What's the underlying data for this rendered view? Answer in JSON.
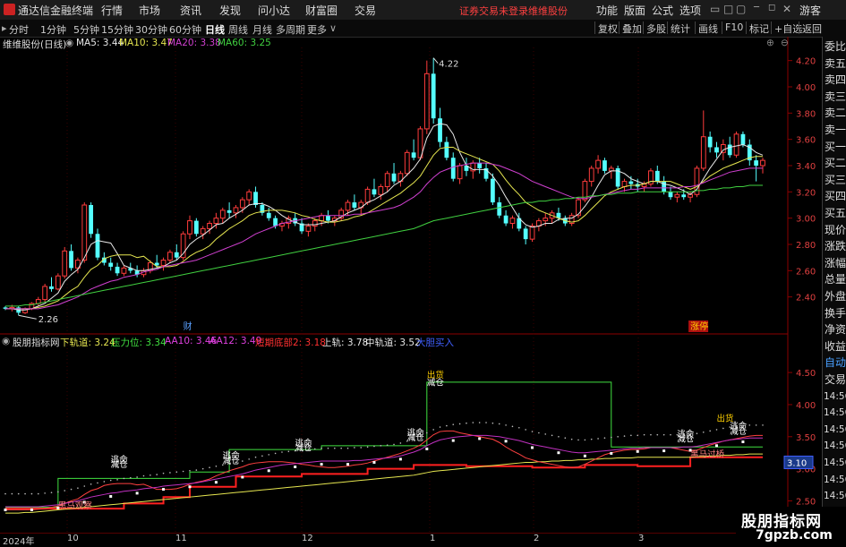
{
  "menubar": {
    "title": "通达信金融终端",
    "items": [
      "行情",
      "市场",
      "资讯",
      "发现",
      "问小达",
      "财富圈",
      "交易"
    ],
    "status": "证券交易未登录",
    "stock_name": "维维股份",
    "right_items": [
      "功能",
      "版面",
      "公式",
      "选项"
    ],
    "guest": "游客"
  },
  "periodbar": {
    "periods": [
      "分时",
      "1分钟",
      "5分钟",
      "15分钟",
      "30分钟",
      "60分钟",
      "日线",
      "周线",
      "月线",
      "多周期",
      "更多"
    ],
    "active_period": "日线",
    "right_buttons": [
      "复权",
      "叠加",
      "多股",
      "统计",
      "画线",
      "F10",
      "标记",
      "+自选",
      "返回"
    ]
  },
  "main_panel": {
    "title": "维维股份(日线)",
    "indicators": [
      {
        "label": "MA5: 3.44",
        "color": "#e8e8e8"
      },
      {
        "label": "MA10: 3.47",
        "color": "#e6e650"
      },
      {
        "label": "MA20: 3.38",
        "color": "#d040d0"
      },
      {
        "label": "MA60: 3.25",
        "color": "#40d040"
      }
    ],
    "high_label": "4.22",
    "low_label": "2.26",
    "markers": [
      {
        "text": "财",
        "color": "#5aa0ff"
      },
      {
        "text": "涨停",
        "color": "#ffd000",
        "bg": "#b01010"
      }
    ],
    "y_ticks": [
      "4.20",
      "4.00",
      "3.80",
      "3.60",
      "3.40",
      "3.20",
      "3.00",
      "2.80",
      "2.60",
      "2.40"
    ]
  },
  "sub_panel": {
    "title": "股朋指标网",
    "indicators": [
      {
        "label": "下轨道: 3.24",
        "color": "#e6e650"
      },
      {
        "label": "压力位: 3.34",
        "color": "#40e040"
      },
      {
        "label": "AA10: 3.46",
        "color": "#e040e0"
      },
      {
        "label": "AA12: 3.49",
        "color": "#e040e0"
      },
      {
        "label": "短期底部2: 3.18",
        "color": "#ff3030"
      },
      {
        "label": "上轨: 3.78",
        "color": "#e8e8e8"
      },
      {
        "label": "中轨道: 3.52",
        "color": "#e8e8e8"
      },
      {
        "label": "大胆买入",
        "color": "#4060ff"
      }
    ],
    "y_ticks": [
      "4.50",
      "4.00",
      "3.50",
      "3.00",
      "2.50"
    ],
    "current_value": "3.10",
    "annotations": [
      "逃命",
      "减仓",
      "逃命",
      "减仓",
      "逃命",
      "减仓",
      "出货",
      "减仓",
      "逃命",
      "减仓",
      "逃命",
      "减仓",
      "出货",
      "逃命",
      "减仓",
      "黑马观察",
      "黑马过桥"
    ]
  },
  "sidebar": {
    "items": [
      "委比",
      "卖五",
      "卖四",
      "卖三",
      "卖二",
      "卖一",
      "买一",
      "买二",
      "买三",
      "买四",
      "买五",
      "现价",
      "涨跌",
      "涨幅",
      "总量",
      "外盘",
      "换手",
      "净资",
      "收益",
      "自动",
      "交易",
      "14:56",
      "14:56",
      "14:56",
      "14:56",
      "14:56",
      "14:56",
      "14:56",
      "14:56"
    ]
  },
  "datebar": {
    "labels": [
      "2024年",
      "10",
      "11",
      "12",
      "1",
      "2",
      "3"
    ]
  },
  "watermark": {
    "line1": "股朋指标网",
    "line2": "7gpzb.com"
  },
  "chart_data": {
    "type": "candlestick",
    "title": "维维股份(日线)",
    "ylim": [
      2.2,
      4.3
    ],
    "candles": [
      [
        2.32,
        2.33,
        2.3,
        2.31
      ],
      [
        2.31,
        2.34,
        2.29,
        2.32
      ],
      [
        2.32,
        2.33,
        2.26,
        2.28
      ],
      [
        2.28,
        2.32,
        2.27,
        2.31
      ],
      [
        2.31,
        2.36,
        2.3,
        2.35
      ],
      [
        2.35,
        2.4,
        2.33,
        2.38
      ],
      [
        2.38,
        2.5,
        2.36,
        2.48
      ],
      [
        2.48,
        2.55,
        2.44,
        2.46
      ],
      [
        2.46,
        2.58,
        2.45,
        2.56
      ],
      [
        2.56,
        2.78,
        2.54,
        2.75
      ],
      [
        2.75,
        2.8,
        2.6,
        2.62
      ],
      [
        2.62,
        2.7,
        2.58,
        2.68
      ],
      [
        2.68,
        3.12,
        2.66,
        3.1
      ],
      [
        3.1,
        3.12,
        2.85,
        2.88
      ],
      [
        2.88,
        2.92,
        2.68,
        2.7
      ],
      [
        2.7,
        2.74,
        2.64,
        2.66
      ],
      [
        2.66,
        2.7,
        2.6,
        2.63
      ],
      [
        2.63,
        2.66,
        2.56,
        2.58
      ],
      [
        2.58,
        2.64,
        2.56,
        2.62
      ],
      [
        2.62,
        2.66,
        2.58,
        2.6
      ],
      [
        2.6,
        2.64,
        2.55,
        2.57
      ],
      [
        2.57,
        2.62,
        2.55,
        2.6
      ],
      [
        2.6,
        2.68,
        2.58,
        2.66
      ],
      [
        2.66,
        2.72,
        2.62,
        2.64
      ],
      [
        2.64,
        2.7,
        2.6,
        2.68
      ],
      [
        2.68,
        2.76,
        2.66,
        2.74
      ],
      [
        2.74,
        2.8,
        2.68,
        2.7
      ],
      [
        2.7,
        2.9,
        2.68,
        2.88
      ],
      [
        2.88,
        3.02,
        2.84,
        2.98
      ],
      [
        2.98,
        3.0,
        2.86,
        2.88
      ],
      [
        2.88,
        2.94,
        2.84,
        2.92
      ],
      [
        2.92,
        2.98,
        2.88,
        2.96
      ],
      [
        2.96,
        3.04,
        2.92,
        3.0
      ],
      [
        3.0,
        3.08,
        2.96,
        3.06
      ],
      [
        3.06,
        3.12,
        3.0,
        3.04
      ],
      [
        3.04,
        3.1,
        3.0,
        3.08
      ],
      [
        3.08,
        3.16,
        3.04,
        3.14
      ],
      [
        3.14,
        3.22,
        3.1,
        3.2
      ],
      [
        3.2,
        3.24,
        3.08,
        3.1
      ],
      [
        3.1,
        3.12,
        3.02,
        3.04
      ],
      [
        3.04,
        3.08,
        2.98,
        3.0
      ],
      [
        3.0,
        3.02,
        2.92,
        2.94
      ],
      [
        2.94,
        2.98,
        2.9,
        2.96
      ],
      [
        2.96,
        3.02,
        2.92,
        3.0
      ],
      [
        3.0,
        3.04,
        2.94,
        2.96
      ],
      [
        2.96,
        3.0,
        2.88,
        2.9
      ],
      [
        2.9,
        2.96,
        2.86,
        2.94
      ],
      [
        2.94,
        3.0,
        2.9,
        2.98
      ],
      [
        2.98,
        3.04,
        2.94,
        3.02
      ],
      [
        3.02,
        3.06,
        2.96,
        2.98
      ],
      [
        2.98,
        3.02,
        2.94,
        3.0
      ],
      [
        3.0,
        3.08,
        2.98,
        3.06
      ],
      [
        3.06,
        3.14,
        3.02,
        3.12
      ],
      [
        3.12,
        3.18,
        3.06,
        3.08
      ],
      [
        3.08,
        3.14,
        3.02,
        3.12
      ],
      [
        3.12,
        3.24,
        3.1,
        3.22
      ],
      [
        3.22,
        3.3,
        3.16,
        3.18
      ],
      [
        3.18,
        3.26,
        3.14,
        3.24
      ],
      [
        3.24,
        3.36,
        3.2,
        3.34
      ],
      [
        3.34,
        3.42,
        3.26,
        3.28
      ],
      [
        3.28,
        3.36,
        3.24,
        3.34
      ],
      [
        3.34,
        3.52,
        3.32,
        3.5
      ],
      [
        3.5,
        3.6,
        3.44,
        3.46
      ],
      [
        3.46,
        3.7,
        3.44,
        3.68
      ],
      [
        3.68,
        4.2,
        3.64,
        4.1
      ],
      [
        4.1,
        4.22,
        3.72,
        3.76
      ],
      [
        3.76,
        3.84,
        3.54,
        3.58
      ],
      [
        3.58,
        3.62,
        3.44,
        3.46
      ],
      [
        3.46,
        3.5,
        3.28,
        3.3
      ],
      [
        3.3,
        3.42,
        3.26,
        3.4
      ],
      [
        3.4,
        3.46,
        3.32,
        3.36
      ],
      [
        3.36,
        3.44,
        3.3,
        3.42
      ],
      [
        3.42,
        3.46,
        3.34,
        3.38
      ],
      [
        3.38,
        3.42,
        3.28,
        3.3
      ],
      [
        3.3,
        3.34,
        3.1,
        3.12
      ],
      [
        3.12,
        3.16,
        3.0,
        3.02
      ],
      [
        3.02,
        3.06,
        2.94,
        2.96
      ],
      [
        2.96,
        3.02,
        2.92,
        3.0
      ],
      [
        3.0,
        3.04,
        2.9,
        2.92
      ],
      [
        2.92,
        2.94,
        2.8,
        2.84
      ],
      [
        2.84,
        2.96,
        2.82,
        2.94
      ],
      [
        2.94,
        3.0,
        2.9,
        2.98
      ],
      [
        2.98,
        3.04,
        2.94,
        3.0
      ],
      [
        3.0,
        3.06,
        2.96,
        3.04
      ],
      [
        3.04,
        3.08,
        2.98,
        3.0
      ],
      [
        3.0,
        3.02,
        2.94,
        2.96
      ],
      [
        2.96,
        3.04,
        2.94,
        3.02
      ],
      [
        3.02,
        3.16,
        3.0,
        3.14
      ],
      [
        3.14,
        3.3,
        3.12,
        3.28
      ],
      [
        3.28,
        3.4,
        3.24,
        3.38
      ],
      [
        3.38,
        3.48,
        3.34,
        3.44
      ],
      [
        3.44,
        3.46,
        3.34,
        3.36
      ],
      [
        3.36,
        3.4,
        3.3,
        3.38
      ],
      [
        3.38,
        3.4,
        3.22,
        3.24
      ],
      [
        3.24,
        3.3,
        3.2,
        3.28
      ],
      [
        3.28,
        3.32,
        3.22,
        3.26
      ],
      [
        3.26,
        3.3,
        3.2,
        3.24
      ],
      [
        3.24,
        3.28,
        3.2,
        3.26
      ],
      [
        3.26,
        3.38,
        3.24,
        3.36
      ],
      [
        3.36,
        3.4,
        3.26,
        3.28
      ],
      [
        3.28,
        3.32,
        3.18,
        3.2
      ],
      [
        3.2,
        3.24,
        3.14,
        3.16
      ],
      [
        3.16,
        3.2,
        3.12,
        3.18
      ],
      [
        3.18,
        3.22,
        3.14,
        3.16
      ],
      [
        3.16,
        3.2,
        3.12,
        3.18
      ],
      [
        3.18,
        3.4,
        3.16,
        3.38
      ],
      [
        3.38,
        3.82,
        3.36,
        3.62
      ],
      [
        3.62,
        3.66,
        3.5,
        3.54
      ],
      [
        3.54,
        3.58,
        3.46,
        3.5
      ],
      [
        3.5,
        3.6,
        3.44,
        3.56
      ],
      [
        3.56,
        3.62,
        3.46,
        3.48
      ],
      [
        3.48,
        3.66,
        3.46,
        3.64
      ],
      [
        3.64,
        3.66,
        3.54,
        3.56
      ],
      [
        3.56,
        3.6,
        3.4,
        3.44
      ],
      [
        3.44,
        3.48,
        3.28,
        3.4
      ],
      [
        3.4,
        3.46,
        3.34,
        3.44
      ]
    ],
    "ma": {
      "MA5": [
        2.31,
        2.31,
        2.3,
        2.3,
        2.31,
        2.33,
        2.35,
        2.39,
        2.43,
        2.52,
        2.57,
        2.61,
        2.7,
        2.8,
        2.83,
        2.82,
        2.81,
        2.73,
        2.64,
        2.62,
        2.6,
        2.6,
        2.61,
        2.62,
        2.63,
        2.66,
        2.68,
        2.73,
        2.8,
        2.84,
        2.87,
        2.91,
        2.95,
        2.96,
        3.0,
        3.03,
        3.06,
        3.1,
        3.11,
        3.11,
        3.09,
        3.06,
        3.02,
        2.99,
        2.97,
        2.95,
        2.95,
        2.95,
        2.96,
        2.97,
        2.98,
        3.01,
        3.04,
        3.06,
        3.08,
        3.12,
        3.14,
        3.17,
        3.2,
        3.25,
        3.28,
        3.33,
        3.38,
        3.45,
        3.61,
        3.7,
        3.72,
        3.71,
        3.64,
        3.5,
        3.4,
        3.37,
        3.37,
        3.37,
        3.32,
        3.25,
        3.16,
        3.08,
        3.0,
        2.95,
        2.93,
        2.94,
        2.96,
        2.96,
        2.99,
        3.0,
        3.0,
        3.03,
        3.09,
        3.16,
        3.25,
        3.33,
        3.36,
        3.36,
        3.34,
        3.3,
        3.28,
        3.26,
        3.28,
        3.28,
        3.26,
        3.25,
        3.23,
        3.21,
        3.18,
        3.22,
        3.3,
        3.38,
        3.45,
        3.52,
        3.54,
        3.55,
        3.56,
        3.54,
        3.5,
        3.48
      ],
      "MA10": [
        2.31,
        2.31,
        2.31,
        2.31,
        2.31,
        2.32,
        2.33,
        2.35,
        2.37,
        2.41,
        2.45,
        2.48,
        2.55,
        2.61,
        2.64,
        2.69,
        2.71,
        2.72,
        2.72,
        2.72,
        2.7,
        2.71,
        2.67,
        2.63,
        2.63,
        2.63,
        2.64,
        2.67,
        2.71,
        2.74,
        2.76,
        2.79,
        2.84,
        2.88,
        2.92,
        2.95,
        2.98,
        3.02,
        3.04,
        3.05,
        3.06,
        3.06,
        3.06,
        3.05,
        3.04,
        3.02,
        3.01,
        2.99,
        2.98,
        2.97,
        2.97,
        2.98,
        2.99,
        3.01,
        3.02,
        3.04,
        3.07,
        3.1,
        3.13,
        3.16,
        3.19,
        3.23,
        3.27,
        3.32,
        3.4,
        3.48,
        3.53,
        3.54,
        3.54,
        3.51,
        3.49,
        3.47,
        3.45,
        3.43,
        3.41,
        3.36,
        3.29,
        3.23,
        3.18,
        3.12,
        3.09,
        3.06,
        3.04,
        3.02,
        3.0,
        2.98,
        2.97,
        2.98,
        3.02,
        3.07,
        3.12,
        3.17,
        3.2,
        3.22,
        3.24,
        3.25,
        3.25,
        3.26,
        3.28,
        3.28,
        3.28,
        3.28,
        3.26,
        3.24,
        3.22,
        3.24,
        3.28,
        3.32,
        3.35,
        3.38,
        3.4,
        3.42,
        3.44,
        3.46,
        3.47,
        3.47
      ],
      "MA20": [
        2.31,
        2.31,
        2.31,
        2.31,
        2.31,
        2.31,
        2.32,
        2.33,
        2.34,
        2.36,
        2.38,
        2.4,
        2.43,
        2.46,
        2.48,
        2.5,
        2.52,
        2.53,
        2.55,
        2.56,
        2.57,
        2.59,
        2.6,
        2.61,
        2.63,
        2.64,
        2.65,
        2.66,
        2.67,
        2.68,
        2.7,
        2.72,
        2.74,
        2.76,
        2.78,
        2.8,
        2.82,
        2.85,
        2.88,
        2.9,
        2.92,
        2.94,
        2.96,
        2.97,
        2.98,
        2.99,
        3.0,
        3.01,
        3.02,
        3.02,
        3.02,
        3.02,
        3.02,
        3.03,
        3.03,
        3.04,
        3.05,
        3.06,
        3.07,
        3.08,
        3.1,
        3.13,
        3.16,
        3.2,
        3.26,
        3.31,
        3.35,
        3.37,
        3.39,
        3.4,
        3.41,
        3.42,
        3.42,
        3.42,
        3.41,
        3.4,
        3.38,
        3.36,
        3.34,
        3.31,
        3.28,
        3.26,
        3.24,
        3.22,
        3.2,
        3.18,
        3.16,
        3.15,
        3.15,
        3.16,
        3.17,
        3.18,
        3.19,
        3.2,
        3.21,
        3.22,
        3.22,
        3.23,
        3.23,
        3.23,
        3.23,
        3.23,
        3.23,
        3.24,
        3.24,
        3.25,
        3.27,
        3.29,
        3.31,
        3.33,
        3.35,
        3.36,
        3.37,
        3.38,
        3.38,
        3.38
      ],
      "MA60": [
        2.33,
        2.33,
        2.33,
        2.34,
        2.34,
        2.35,
        2.36,
        2.37,
        2.38,
        2.39,
        2.4,
        2.41,
        2.42,
        2.43,
        2.44,
        2.45,
        2.46,
        2.47,
        2.48,
        2.49,
        2.5,
        2.51,
        2.52,
        2.53,
        2.54,
        2.55,
        2.56,
        2.57,
        2.58,
        2.59,
        2.6,
        2.61,
        2.62,
        2.63,
        2.64,
        2.65,
        2.66,
        2.67,
        2.68,
        2.69,
        2.7,
        2.71,
        2.72,
        2.73,
        2.74,
        2.75,
        2.76,
        2.77,
        2.78,
        2.79,
        2.8,
        2.81,
        2.82,
        2.83,
        2.84,
        2.85,
        2.86,
        2.87,
        2.88,
        2.89,
        2.9,
        2.91,
        2.92,
        2.94,
        2.96,
        2.98,
        2.99,
        3.0,
        3.01,
        3.02,
        3.03,
        3.04,
        3.05,
        3.06,
        3.07,
        3.08,
        3.09,
        3.1,
        3.11,
        3.12,
        3.12,
        3.13,
        3.13,
        3.14,
        3.14,
        3.15,
        3.15,
        3.16,
        3.16,
        3.17,
        3.17,
        3.18,
        3.18,
        3.19,
        3.19,
        3.19,
        3.2,
        3.2,
        3.2,
        3.2,
        3.2,
        3.2,
        3.2,
        3.2,
        3.2,
        3.21,
        3.21,
        3.22,
        3.22,
        3.23,
        3.23,
        3.24,
        3.24,
        3.25,
        3.25,
        3.25
      ]
    }
  }
}
